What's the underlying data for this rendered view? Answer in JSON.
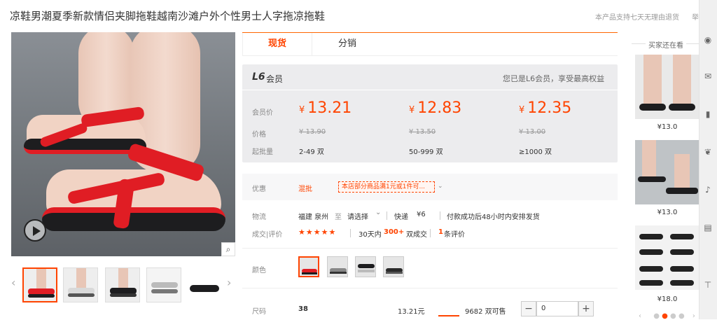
{
  "product": {
    "title": "凉鞋男潮夏季新款情侣夹脚拖鞋越南沙滩户外个性男士人字拖凉拖鞋",
    "policy": "本产品支持七天无理由退货",
    "policy_cut": "举"
  },
  "gallery": {
    "zoom_icon": "magnifier-icon",
    "prev": "‹",
    "next": "›"
  },
  "tabs": [
    {
      "label": "现货"
    },
    {
      "label": "分销"
    }
  ],
  "member": {
    "level": "L6",
    "level_suffix": "会员",
    "tip": "您已是L6会员，享受最高权益",
    "price_label": "会员价",
    "orig_label": "价格",
    "qty_label": "起批量",
    "tiers": [
      {
        "price": "13.21",
        "orig": "¥ 13.90",
        "qty": "2-49 双"
      },
      {
        "price": "12.83",
        "orig": "¥ 13.50",
        "qty": "50-999 双"
      },
      {
        "price": "12.35",
        "orig": "¥ 13.00",
        "qty": "≥1000 双"
      }
    ],
    "currency": "¥"
  },
  "promo": {
    "label": "优惠",
    "tag": "混批",
    "coupon": "本店部分商品满1元或1件可...",
    "more": "⌄"
  },
  "shipping": {
    "label": "物流",
    "from": "福建 泉州",
    "to_word": "至",
    "to": "请选择",
    "method": "快递",
    "fee": "¥6",
    "note": "付款成功后48小时内安排发货"
  },
  "deals": {
    "label": "成交|评价",
    "stars": "★★★★★",
    "period": "30天内",
    "count": "300+",
    "unit": "双成交",
    "reviews": "1",
    "reviews_unit": "条评价"
  },
  "color": {
    "label": "颜色"
  },
  "size_row": {
    "label": "尺码",
    "size": "38",
    "price": "13.21元",
    "stock": "9682 双可售",
    "minus": "−",
    "qty": "0",
    "plus": "+"
  },
  "buyers": {
    "title": "买家还在看",
    "items": [
      {
        "price": "¥13.0"
      },
      {
        "price": "¥13.0"
      },
      {
        "price": "¥18.0"
      }
    ]
  },
  "colors": {
    "accent": "#ff4400",
    "strap_red": "#e01d24"
  }
}
